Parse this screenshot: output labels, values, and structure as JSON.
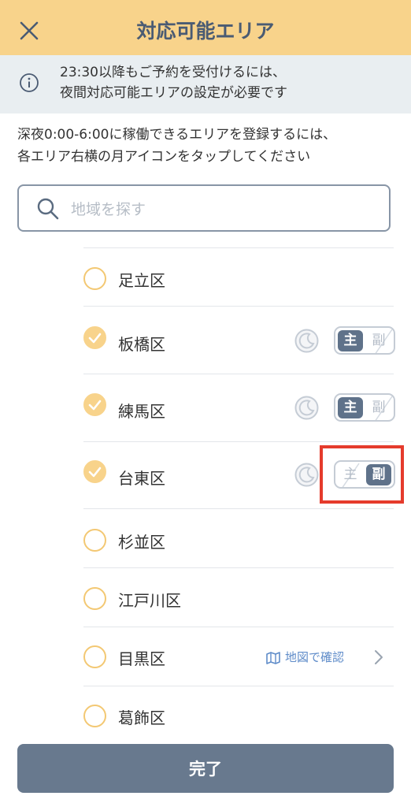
{
  "header": {
    "title": "対応可能エリア",
    "close_icon": "close-icon"
  },
  "notice": {
    "icon": "info-icon",
    "line1": "23:30以降もご予約を受付けるには、",
    "line2": "夜間対応可能エリアの設定が必要です"
  },
  "instruction": {
    "line1": "深夜0:00-6:00に稼働できるエリアを登録するには、",
    "line2": "各エリア右横の月アイコンをタップしてください"
  },
  "search": {
    "placeholder": "地域を探す",
    "value": ""
  },
  "areas": [
    {
      "label": "足立区",
      "checked": false
    },
    {
      "label": "板橋区",
      "checked": true,
      "main_label": "主",
      "sub_label": "副",
      "selected": "主"
    },
    {
      "label": "練馬区",
      "checked": true,
      "main_label": "主",
      "sub_label": "副",
      "selected": "主"
    },
    {
      "label": "台東区",
      "checked": true,
      "main_label": "主",
      "sub_label": "副",
      "selected": "副"
    },
    {
      "label": "杉並区",
      "checked": false
    },
    {
      "label": "江戸川区",
      "checked": false
    },
    {
      "label": "目黒区",
      "checked": false,
      "map_link": "地図で確認"
    },
    {
      "label": "葛飾区",
      "checked": false
    }
  ],
  "footer": {
    "done_label": "完了"
  },
  "colors": {
    "accent": "#f8d38b",
    "primary": "#68798e",
    "highlight": "#e53b2c",
    "link": "#5f8cc9"
  }
}
